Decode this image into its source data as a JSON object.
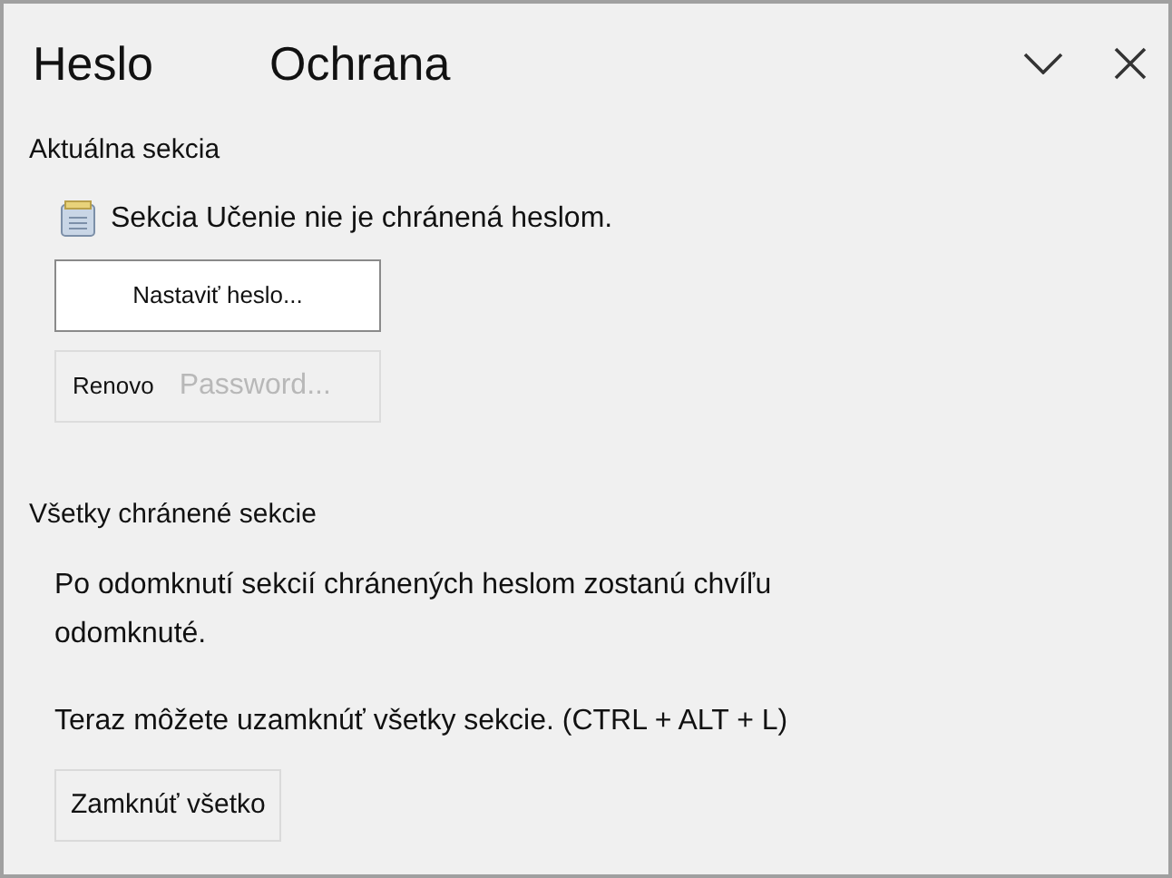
{
  "title": {
    "parts": [
      "Heslo",
      "Ochrana"
    ]
  },
  "header_buttons": [
    {
      "kind": "collapse"
    },
    {
      "kind": "close"
    }
  ],
  "current_section": {
    "heading": "Aktuálna sekcia",
    "status": "Sekcia Učenie nie je chránená heslom.",
    "buttons": [
      {
        "label": "Nastaviť heslo...",
        "disabled": false
      },
      {
        "label": "Renovo",
        "label_2": "Password...",
        "disabled": true
      }
    ]
  },
  "all_sections": {
    "heading": "Všetky chránené sekcie",
    "note": "Po odomknutí sekcií chránených heslom zostanú chvíľu odomknuté.",
    "hint": "Teraz môžete uzamknúť všetky sekcie. (CTRL + ALT + L)",
    "button": {
      "label": "Zamknúť všetko",
      "disabled": false
    }
  }
}
